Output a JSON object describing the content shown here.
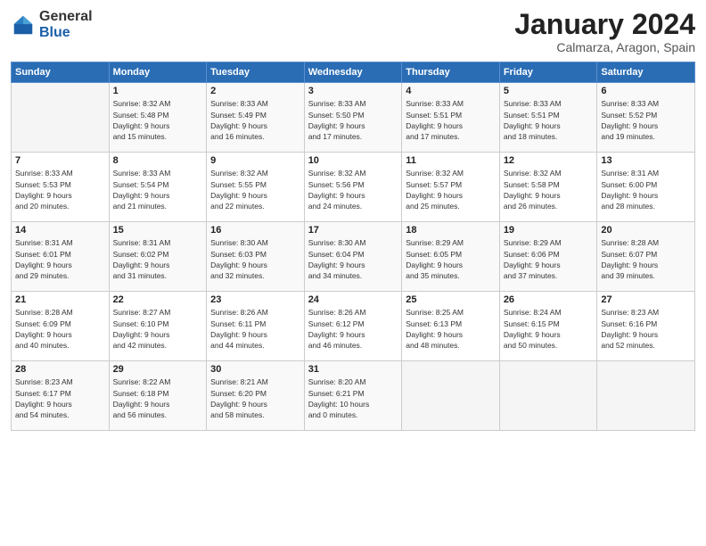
{
  "logo": {
    "general": "General",
    "blue": "Blue"
  },
  "title": {
    "month": "January 2024",
    "location": "Calmarza, Aragon, Spain"
  },
  "weekdays": [
    "Sunday",
    "Monday",
    "Tuesday",
    "Wednesday",
    "Thursday",
    "Friday",
    "Saturday"
  ],
  "weeks": [
    [
      {
        "day": "",
        "info": ""
      },
      {
        "day": "1",
        "info": "Sunrise: 8:32 AM\nSunset: 5:48 PM\nDaylight: 9 hours\nand 15 minutes."
      },
      {
        "day": "2",
        "info": "Sunrise: 8:33 AM\nSunset: 5:49 PM\nDaylight: 9 hours\nand 16 minutes."
      },
      {
        "day": "3",
        "info": "Sunrise: 8:33 AM\nSunset: 5:50 PM\nDaylight: 9 hours\nand 17 minutes."
      },
      {
        "day": "4",
        "info": "Sunrise: 8:33 AM\nSunset: 5:51 PM\nDaylight: 9 hours\nand 17 minutes."
      },
      {
        "day": "5",
        "info": "Sunrise: 8:33 AM\nSunset: 5:51 PM\nDaylight: 9 hours\nand 18 minutes."
      },
      {
        "day": "6",
        "info": "Sunrise: 8:33 AM\nSunset: 5:52 PM\nDaylight: 9 hours\nand 19 minutes."
      }
    ],
    [
      {
        "day": "7",
        "info": "Sunrise: 8:33 AM\nSunset: 5:53 PM\nDaylight: 9 hours\nand 20 minutes."
      },
      {
        "day": "8",
        "info": "Sunrise: 8:33 AM\nSunset: 5:54 PM\nDaylight: 9 hours\nand 21 minutes."
      },
      {
        "day": "9",
        "info": "Sunrise: 8:32 AM\nSunset: 5:55 PM\nDaylight: 9 hours\nand 22 minutes."
      },
      {
        "day": "10",
        "info": "Sunrise: 8:32 AM\nSunset: 5:56 PM\nDaylight: 9 hours\nand 24 minutes."
      },
      {
        "day": "11",
        "info": "Sunrise: 8:32 AM\nSunset: 5:57 PM\nDaylight: 9 hours\nand 25 minutes."
      },
      {
        "day": "12",
        "info": "Sunrise: 8:32 AM\nSunset: 5:58 PM\nDaylight: 9 hours\nand 26 minutes."
      },
      {
        "day": "13",
        "info": "Sunrise: 8:31 AM\nSunset: 6:00 PM\nDaylight: 9 hours\nand 28 minutes."
      }
    ],
    [
      {
        "day": "14",
        "info": "Sunrise: 8:31 AM\nSunset: 6:01 PM\nDaylight: 9 hours\nand 29 minutes."
      },
      {
        "day": "15",
        "info": "Sunrise: 8:31 AM\nSunset: 6:02 PM\nDaylight: 9 hours\nand 31 minutes."
      },
      {
        "day": "16",
        "info": "Sunrise: 8:30 AM\nSunset: 6:03 PM\nDaylight: 9 hours\nand 32 minutes."
      },
      {
        "day": "17",
        "info": "Sunrise: 8:30 AM\nSunset: 6:04 PM\nDaylight: 9 hours\nand 34 minutes."
      },
      {
        "day": "18",
        "info": "Sunrise: 8:29 AM\nSunset: 6:05 PM\nDaylight: 9 hours\nand 35 minutes."
      },
      {
        "day": "19",
        "info": "Sunrise: 8:29 AM\nSunset: 6:06 PM\nDaylight: 9 hours\nand 37 minutes."
      },
      {
        "day": "20",
        "info": "Sunrise: 8:28 AM\nSunset: 6:07 PM\nDaylight: 9 hours\nand 39 minutes."
      }
    ],
    [
      {
        "day": "21",
        "info": "Sunrise: 8:28 AM\nSunset: 6:09 PM\nDaylight: 9 hours\nand 40 minutes."
      },
      {
        "day": "22",
        "info": "Sunrise: 8:27 AM\nSunset: 6:10 PM\nDaylight: 9 hours\nand 42 minutes."
      },
      {
        "day": "23",
        "info": "Sunrise: 8:26 AM\nSunset: 6:11 PM\nDaylight: 9 hours\nand 44 minutes."
      },
      {
        "day": "24",
        "info": "Sunrise: 8:26 AM\nSunset: 6:12 PM\nDaylight: 9 hours\nand 46 minutes."
      },
      {
        "day": "25",
        "info": "Sunrise: 8:25 AM\nSunset: 6:13 PM\nDaylight: 9 hours\nand 48 minutes."
      },
      {
        "day": "26",
        "info": "Sunrise: 8:24 AM\nSunset: 6:15 PM\nDaylight: 9 hours\nand 50 minutes."
      },
      {
        "day": "27",
        "info": "Sunrise: 8:23 AM\nSunset: 6:16 PM\nDaylight: 9 hours\nand 52 minutes."
      }
    ],
    [
      {
        "day": "28",
        "info": "Sunrise: 8:23 AM\nSunset: 6:17 PM\nDaylight: 9 hours\nand 54 minutes."
      },
      {
        "day": "29",
        "info": "Sunrise: 8:22 AM\nSunset: 6:18 PM\nDaylight: 9 hours\nand 56 minutes."
      },
      {
        "day": "30",
        "info": "Sunrise: 8:21 AM\nSunset: 6:20 PM\nDaylight: 9 hours\nand 58 minutes."
      },
      {
        "day": "31",
        "info": "Sunrise: 8:20 AM\nSunset: 6:21 PM\nDaylight: 10 hours\nand 0 minutes."
      },
      {
        "day": "",
        "info": ""
      },
      {
        "day": "",
        "info": ""
      },
      {
        "day": "",
        "info": ""
      }
    ]
  ]
}
